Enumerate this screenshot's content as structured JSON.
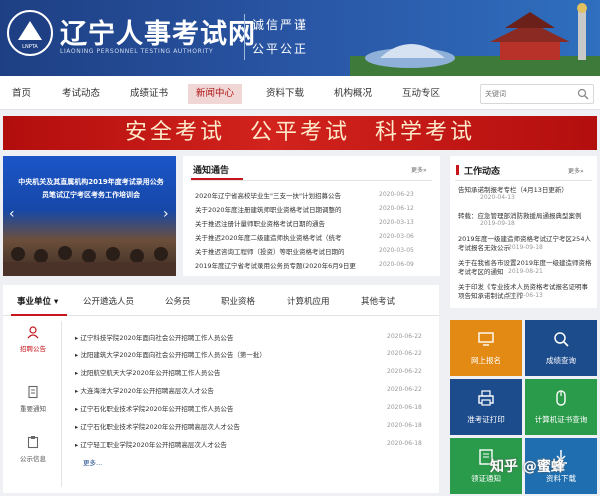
{
  "header": {
    "logo_abbr": "LNPTA",
    "title": "辽宁人事考试网",
    "subtitle": "LIAONING PERSONNEL TESTING AUTHORITY",
    "motto1": "诚信严谨",
    "motto2": "公平公正"
  },
  "nav": {
    "items": [
      "首页",
      "考试动态",
      "成绩证书",
      "新闻中心",
      "资料下载",
      "机构概况",
      "互动专区"
    ],
    "active": "新闻中心",
    "search_placeholder": "关键词"
  },
  "banner": {
    "text": "安全考试　公平考试　科学考试"
  },
  "slider": {
    "caption": "中央机关及其直属机构2019年度考试录用公务员笔试辽宁考区考务工作培训会"
  },
  "notice": {
    "title": "通知通告",
    "more": "更多»",
    "items": [
      {
        "text": "2020年辽宁省高校毕业生\"三支一扶\"计划招募公告",
        "date": "2020-06-23"
      },
      {
        "text": "关于2020年度注册建筑师职业资格考试日期调整的",
        "date": "2020-06-12"
      },
      {
        "text": "关于推迟注册计量师职业资格考试日期的通告",
        "date": "2020-03-13"
      },
      {
        "text": "关于推迟2020年度二级建造师执业资格考试（统考",
        "date": "2020-03-06"
      },
      {
        "text": "关于推迟咨询工程师（投资）等职业资格考试日期的",
        "date": "2020-03-05"
      },
      {
        "text": "2019年度辽宁省考试录用公务员专题(2020年6月9日更",
        "date": "2020-06-09"
      }
    ]
  },
  "work": {
    "title": "工作动态",
    "more": "更多»",
    "items": [
      {
        "text": "告知承诺制报考专栏（4月13日更新）",
        "date": "2020-04-13"
      },
      {
        "text": "转载：应急管理部消防救援局通报典型案例",
        "date": "2019-09-18"
      },
      {
        "text": "2019年度一级建造师资格考试辽宁考区254人考试报名无效公示",
        "date": "2019-09-18"
      },
      {
        "text": "关于在我省各市设置2019年度一级建造师资格考试考区的通知",
        "date": "2019-08-21"
      },
      {
        "text": "关于印发《专业技术人员资格考试报名证明事项告知承诺制试点工作",
        "date": "2019-06-13"
      }
    ]
  },
  "tabs": {
    "items": [
      "事业单位 ▾",
      "公开遴选人员",
      "公务员",
      "职业资格",
      "计算机应用",
      "其他考试"
    ],
    "categories": [
      "招聘公告",
      "重要通知",
      "公示信息"
    ],
    "list": [
      {
        "text": "辽宁科技学院2020年面向社会公开招聘工作人员公告",
        "date": "2020-06-22"
      },
      {
        "text": "沈阳建筑大学2020年面向社会公开招聘工作人员公告（第一批）",
        "date": "2020-06-22"
      },
      {
        "text": "沈阳航空航天大学2020年公开招聘工作人员公告",
        "date": "2020-06-22"
      },
      {
        "text": "大连海洋大学2020年公开招聘高层次人才公告",
        "date": "2020-06-22"
      },
      {
        "text": "辽宁石化职业技术学院2020年公开招聘工作人员公告",
        "date": "2020-06-18"
      },
      {
        "text": "辽宁石化职业技术学院2020年公开招聘高层次人才公告",
        "date": "2020-06-18"
      },
      {
        "text": "辽宁轻工职业学院2020年公开招聘高层次人才公告",
        "date": "2020-06-18"
      }
    ],
    "more": "更多..."
  },
  "services": [
    {
      "label": "网上报名",
      "color": "#e38a14",
      "icon": "computer-icon"
    },
    {
      "label": "成绩查询",
      "color": "#1d4c8c",
      "icon": "search-icon"
    },
    {
      "label": "准考证打印",
      "color": "#1d4c8c",
      "icon": "printer-icon"
    },
    {
      "label": "计算机证书查询",
      "color": "#2a9a4b",
      "icon": "mouse-icon"
    },
    {
      "label": "领证通知",
      "color": "#2a9a4b",
      "icon": "notice-icon"
    },
    {
      "label": "资料下载",
      "color": "#1f6fb0",
      "icon": "download-icon"
    }
  ],
  "watermark": "知乎 @蜜蜂"
}
